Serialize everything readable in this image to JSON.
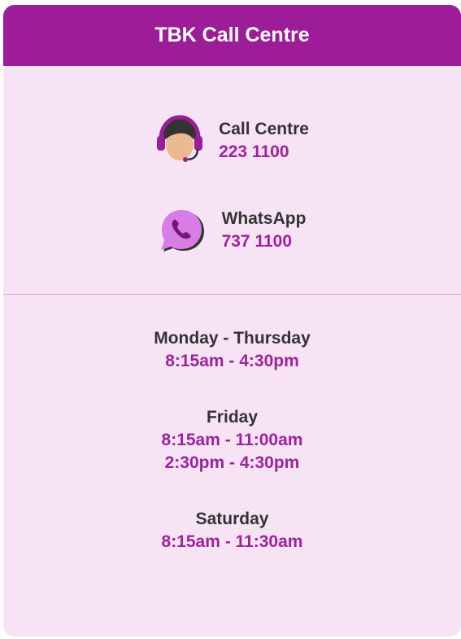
{
  "header": {
    "title": "TBK Call Centre"
  },
  "contacts": [
    {
      "icon": "headset-agent-icon",
      "label": "Call Centre",
      "number": "223 1100"
    },
    {
      "icon": "whatsapp-phone-icon",
      "label": "WhatsApp",
      "number": "737 1100"
    }
  ],
  "hours": [
    {
      "day": "Monday - Thursday",
      "times": [
        "8:15am - 4:30pm"
      ]
    },
    {
      "day": "Friday",
      "times": [
        "8:15am - 11:00am",
        "2:30pm - 4:30pm"
      ]
    },
    {
      "day": "Saturday",
      "times": [
        "8:15am - 11:30am"
      ]
    }
  ],
  "colors": {
    "header_bg": "#9d1c98",
    "card_bg": "#f6e4f5",
    "accent_text": "#a0219d",
    "dark_text": "#333333",
    "divider": "#e3a7e0"
  }
}
